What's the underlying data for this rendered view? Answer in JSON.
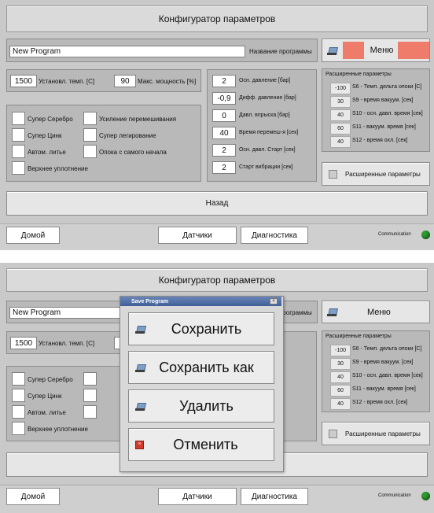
{
  "header": {
    "title": "Конфигуратор параметров"
  },
  "program": {
    "name": "New Program",
    "name_label": "Название программы"
  },
  "menu_label": "Меню",
  "temp": {
    "value": "1500",
    "label": "Установл. темп. [C]",
    "power_value": "90",
    "power_label": "Макс. мощность [%]"
  },
  "checks_left": [
    "Супер Серебро",
    "Супер Цинк",
    "Автом. литье",
    "Верхнее уплотнение"
  ],
  "checks_right": [
    "Усиление перемешивания",
    "Супер легирование",
    "Опока с самого начала"
  ],
  "params": [
    {
      "value": "2",
      "label": "Осн. давление [бар]"
    },
    {
      "value": "-0,9",
      "label": "Дифф. давление [бар]"
    },
    {
      "value": "0",
      "label": "Давл. впрыска [бар]"
    },
    {
      "value": "40",
      "label": "Время перемеш-я [сек]"
    },
    {
      "value": "2",
      "label": "Осн. давл. Старт [сек]"
    },
    {
      "value": "2",
      "label": "Старт вибрации [сек]"
    }
  ],
  "advanced": {
    "title": "Расширенные параметры",
    "rows": [
      {
        "value": "-100",
        "label": "S6 - Темп. дельта опоки [C]"
      },
      {
        "value": "30",
        "label": "S9 - время вакуум. [сек]"
      },
      {
        "value": "40",
        "label": "S10 - осн. давл. время [сек]"
      },
      {
        "value": "60",
        "label": "S11 - вакуум. время [сек]"
      },
      {
        "value": "40",
        "label": "S12 - время охл. [сек]"
      }
    ],
    "button_label": "Расширенные параметры"
  },
  "back_label": "Назад",
  "footer": {
    "home": "Домой",
    "sensors": "Датчики",
    "diagnostics": "Диагностика",
    "comm": "Communication"
  },
  "dialog": {
    "title": "Save Program",
    "save": "Сохранить",
    "save_as": "Сохранить как",
    "delete": "Удалить",
    "cancel": "Отменить"
  },
  "colors": {
    "menu_accent": "#ef7b6a",
    "comm_ok": "#2e9a2e"
  }
}
